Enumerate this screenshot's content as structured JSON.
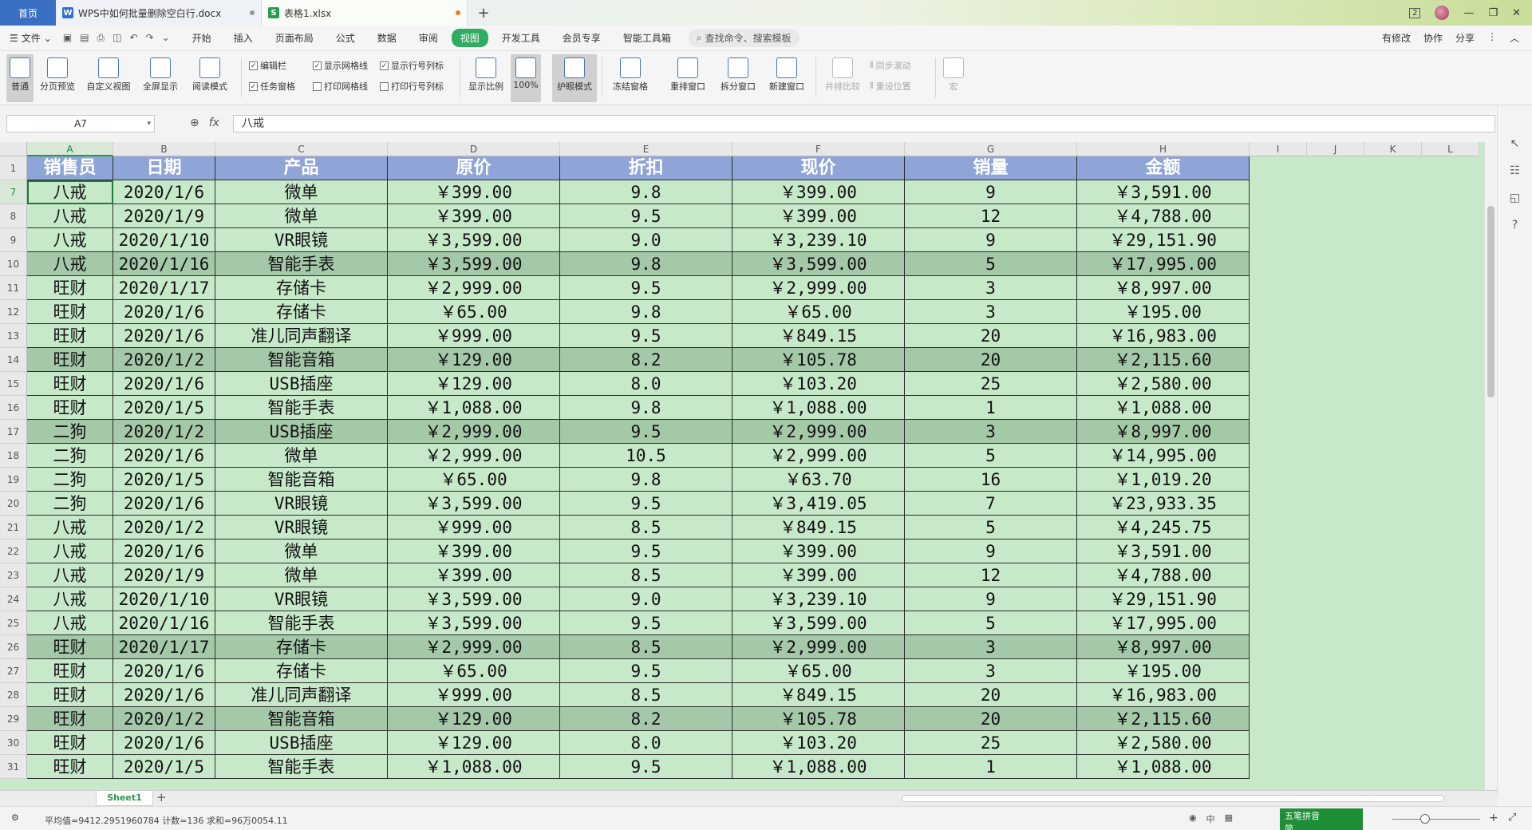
{
  "titlebar": {
    "home": "首页",
    "tabs": [
      {
        "label": "WPS中如何批量删除空白行.docx",
        "icon": "W",
        "color": "#2d6fd6"
      },
      {
        "label": "表格1.xlsx",
        "icon": "S",
        "color": "#22a052"
      }
    ],
    "badge": "2"
  },
  "menubar": {
    "file": "文件",
    "items": [
      "开始",
      "插入",
      "页面布局",
      "公式",
      "数据",
      "审阅",
      "视图",
      "开发工具",
      "会员专享",
      "智能工具箱"
    ],
    "active": "视图",
    "search": "查找命令、搜索模板",
    "right": [
      "有修改",
      "协作",
      "分享"
    ]
  },
  "ribbon": {
    "normal": "普通",
    "page_break": "分页预览",
    "custom_view": "自定义视图",
    "fullscreen": "全屏显示",
    "reading": "阅读模式",
    "chk_edit_bar": "编辑栏",
    "chk_gridlines": "显示网格线",
    "chk_rowcol": "显示行号列标",
    "chk_task": "任务窗格",
    "chk_print_grid": "打印网格线",
    "chk_print_rowcol": "打印行号列标",
    "zoom": "显示比例",
    "zoom100": "100%",
    "eye": "护眼模式",
    "freeze": "冻结窗格",
    "arrange": "重排窗口",
    "split": "拆分窗口",
    "new_window": "新建窗口",
    "compare": "并排比较",
    "sync": "同步滚动",
    "reset": "重设位置",
    "macro": "宏"
  },
  "formulabar": {
    "cell_ref": "A7",
    "fx": "fx",
    "value": "八戒"
  },
  "columns": [
    "A",
    "B",
    "C",
    "D",
    "E",
    "F",
    "G",
    "H",
    "I",
    "J",
    "K",
    "L"
  ],
  "header_row": {
    "num": "1",
    "cells": [
      "销售员",
      "日期",
      "产品",
      "原价",
      "折扣",
      "现价",
      "销量",
      "金额"
    ]
  },
  "rows": [
    {
      "num": "7",
      "dark": false,
      "cells": [
        "八戒",
        "2020/1/6",
        "微单",
        "￥399.00",
        "9.8",
        "￥399.00",
        "9",
        "￥3,591.00"
      ]
    },
    {
      "num": "8",
      "dark": false,
      "cells": [
        "八戒",
        "2020/1/9",
        "微单",
        "￥399.00",
        "9.5",
        "￥399.00",
        "12",
        "￥4,788.00"
      ]
    },
    {
      "num": "9",
      "dark": false,
      "cells": [
        "八戒",
        "2020/1/10",
        "VR眼镜",
        "￥3,599.00",
        "9.0",
        "￥3,239.10",
        "9",
        "￥29,151.90"
      ]
    },
    {
      "num": "10",
      "dark": true,
      "cells": [
        "八戒",
        "2020/1/16",
        "智能手表",
        "￥3,599.00",
        "9.8",
        "￥3,599.00",
        "5",
        "￥17,995.00"
      ]
    },
    {
      "num": "11",
      "dark": false,
      "cells": [
        "旺财",
        "2020/1/17",
        "存储卡",
        "￥2,999.00",
        "9.5",
        "￥2,999.00",
        "3",
        "￥8,997.00"
      ]
    },
    {
      "num": "12",
      "dark": false,
      "cells": [
        "旺财",
        "2020/1/6",
        "存储卡",
        "￥65.00",
        "9.8",
        "￥65.00",
        "3",
        "￥195.00"
      ]
    },
    {
      "num": "13",
      "dark": false,
      "cells": [
        "旺财",
        "2020/1/6",
        "准儿同声翻译",
        "￥999.00",
        "9.5",
        "￥849.15",
        "20",
        "￥16,983.00"
      ]
    },
    {
      "num": "14",
      "dark": true,
      "cells": [
        "旺财",
        "2020/1/2",
        "智能音箱",
        "￥129.00",
        "8.2",
        "￥105.78",
        "20",
        "￥2,115.60"
      ]
    },
    {
      "num": "15",
      "dark": false,
      "cells": [
        "旺财",
        "2020/1/6",
        "USB插座",
        "￥129.00",
        "8.0",
        "￥103.20",
        "25",
        "￥2,580.00"
      ]
    },
    {
      "num": "16",
      "dark": false,
      "cells": [
        "旺财",
        "2020/1/5",
        "智能手表",
        "￥1,088.00",
        "9.8",
        "￥1,088.00",
        "1",
        "￥1,088.00"
      ]
    },
    {
      "num": "17",
      "dark": true,
      "cells": [
        "二狗",
        "2020/1/2",
        "USB插座",
        "￥2,999.00",
        "9.5",
        "￥2,999.00",
        "3",
        "￥8,997.00"
      ]
    },
    {
      "num": "18",
      "dark": false,
      "cells": [
        "二狗",
        "2020/1/6",
        "微单",
        "￥2,999.00",
        "10.5",
        "￥2,999.00",
        "5",
        "￥14,995.00"
      ]
    },
    {
      "num": "19",
      "dark": false,
      "cells": [
        "二狗",
        "2020/1/5",
        "智能音箱",
        "￥65.00",
        "9.8",
        "￥63.70",
        "16",
        "￥1,019.20"
      ]
    },
    {
      "num": "20",
      "dark": false,
      "cells": [
        "二狗",
        "2020/1/6",
        "VR眼镜",
        "￥3,599.00",
        "9.5",
        "￥3,419.05",
        "7",
        "￥23,933.35"
      ]
    },
    {
      "num": "21",
      "dark": false,
      "cells": [
        "八戒",
        "2020/1/2",
        "VR眼镜",
        "￥999.00",
        "8.5",
        "￥849.15",
        "5",
        "￥4,245.75"
      ]
    },
    {
      "num": "22",
      "dark": false,
      "cells": [
        "八戒",
        "2020/1/6",
        "微单",
        "￥399.00",
        "9.5",
        "￥399.00",
        "9",
        "￥3,591.00"
      ]
    },
    {
      "num": "23",
      "dark": false,
      "cells": [
        "八戒",
        "2020/1/9",
        "微单",
        "￥399.00",
        "8.5",
        "￥399.00",
        "12",
        "￥4,788.00"
      ]
    },
    {
      "num": "24",
      "dark": false,
      "cells": [
        "八戒",
        "2020/1/10",
        "VR眼镜",
        "￥3,599.00",
        "9.0",
        "￥3,239.10",
        "9",
        "￥29,151.90"
      ]
    },
    {
      "num": "25",
      "dark": false,
      "cells": [
        "八戒",
        "2020/1/16",
        "智能手表",
        "￥3,599.00",
        "9.5",
        "￥3,599.00",
        "5",
        "￥17,995.00"
      ]
    },
    {
      "num": "26",
      "dark": true,
      "cells": [
        "旺财",
        "2020/1/17",
        "存储卡",
        "￥2,999.00",
        "8.5",
        "￥2,999.00",
        "3",
        "￥8,997.00"
      ]
    },
    {
      "num": "27",
      "dark": false,
      "cells": [
        "旺财",
        "2020/1/6",
        "存储卡",
        "￥65.00",
        "9.5",
        "￥65.00",
        "3",
        "￥195.00"
      ]
    },
    {
      "num": "28",
      "dark": false,
      "cells": [
        "旺财",
        "2020/1/6",
        "准儿同声翻译",
        "￥999.00",
        "8.5",
        "￥849.15",
        "20",
        "￥16,983.00"
      ]
    },
    {
      "num": "29",
      "dark": true,
      "cells": [
        "旺财",
        "2020/1/2",
        "智能音箱",
        "￥129.00",
        "8.2",
        "￥105.78",
        "20",
        "￥2,115.60"
      ]
    },
    {
      "num": "30",
      "dark": false,
      "cells": [
        "旺财",
        "2020/1/6",
        "USB插座",
        "￥129.00",
        "8.0",
        "￥103.20",
        "25",
        "￥2,580.00"
      ]
    },
    {
      "num": "31",
      "dark": false,
      "cells": [
        "旺财",
        "2020/1/5",
        "智能手表",
        "￥1,088.00",
        "9.5",
        "￥1,088.00",
        "1",
        "￥1,088.00"
      ]
    }
  ],
  "sheet": {
    "tab": "Sheet1",
    "add": "+"
  },
  "statusbar": {
    "stats": "平均值=9412.2951960784  计数=136  求和=96万0054.11",
    "ime_line1": "五笔拼音",
    "ime_line2": "简",
    "ime_mode": "中"
  },
  "colors": {
    "header_fill": "#8fa5d8",
    "sheet_bg": "#c7e9c9",
    "dark_row": "#a5c8a9",
    "accent": "#2eac62"
  }
}
